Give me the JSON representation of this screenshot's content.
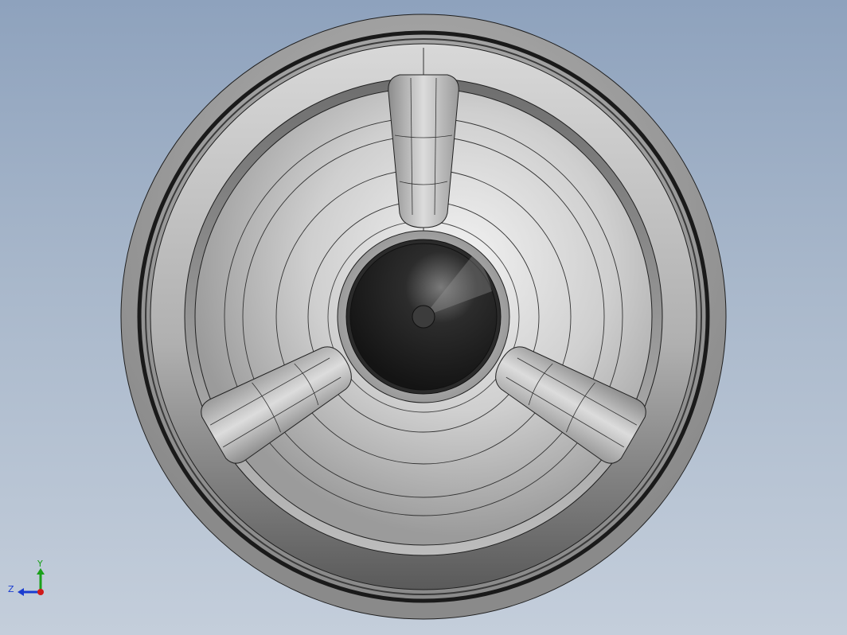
{
  "viewport": {
    "background_top": "#8ea2bd",
    "background_bottom": "#c4cedb"
  },
  "model": {
    "part": "impeller-cover-front-view",
    "vanes": 3
  },
  "triad": {
    "y_label": "Y",
    "z_label": "Z",
    "colors": {
      "y": "#1aa01a",
      "z": "#1a3cd0",
      "x": "#d01a1a"
    }
  }
}
